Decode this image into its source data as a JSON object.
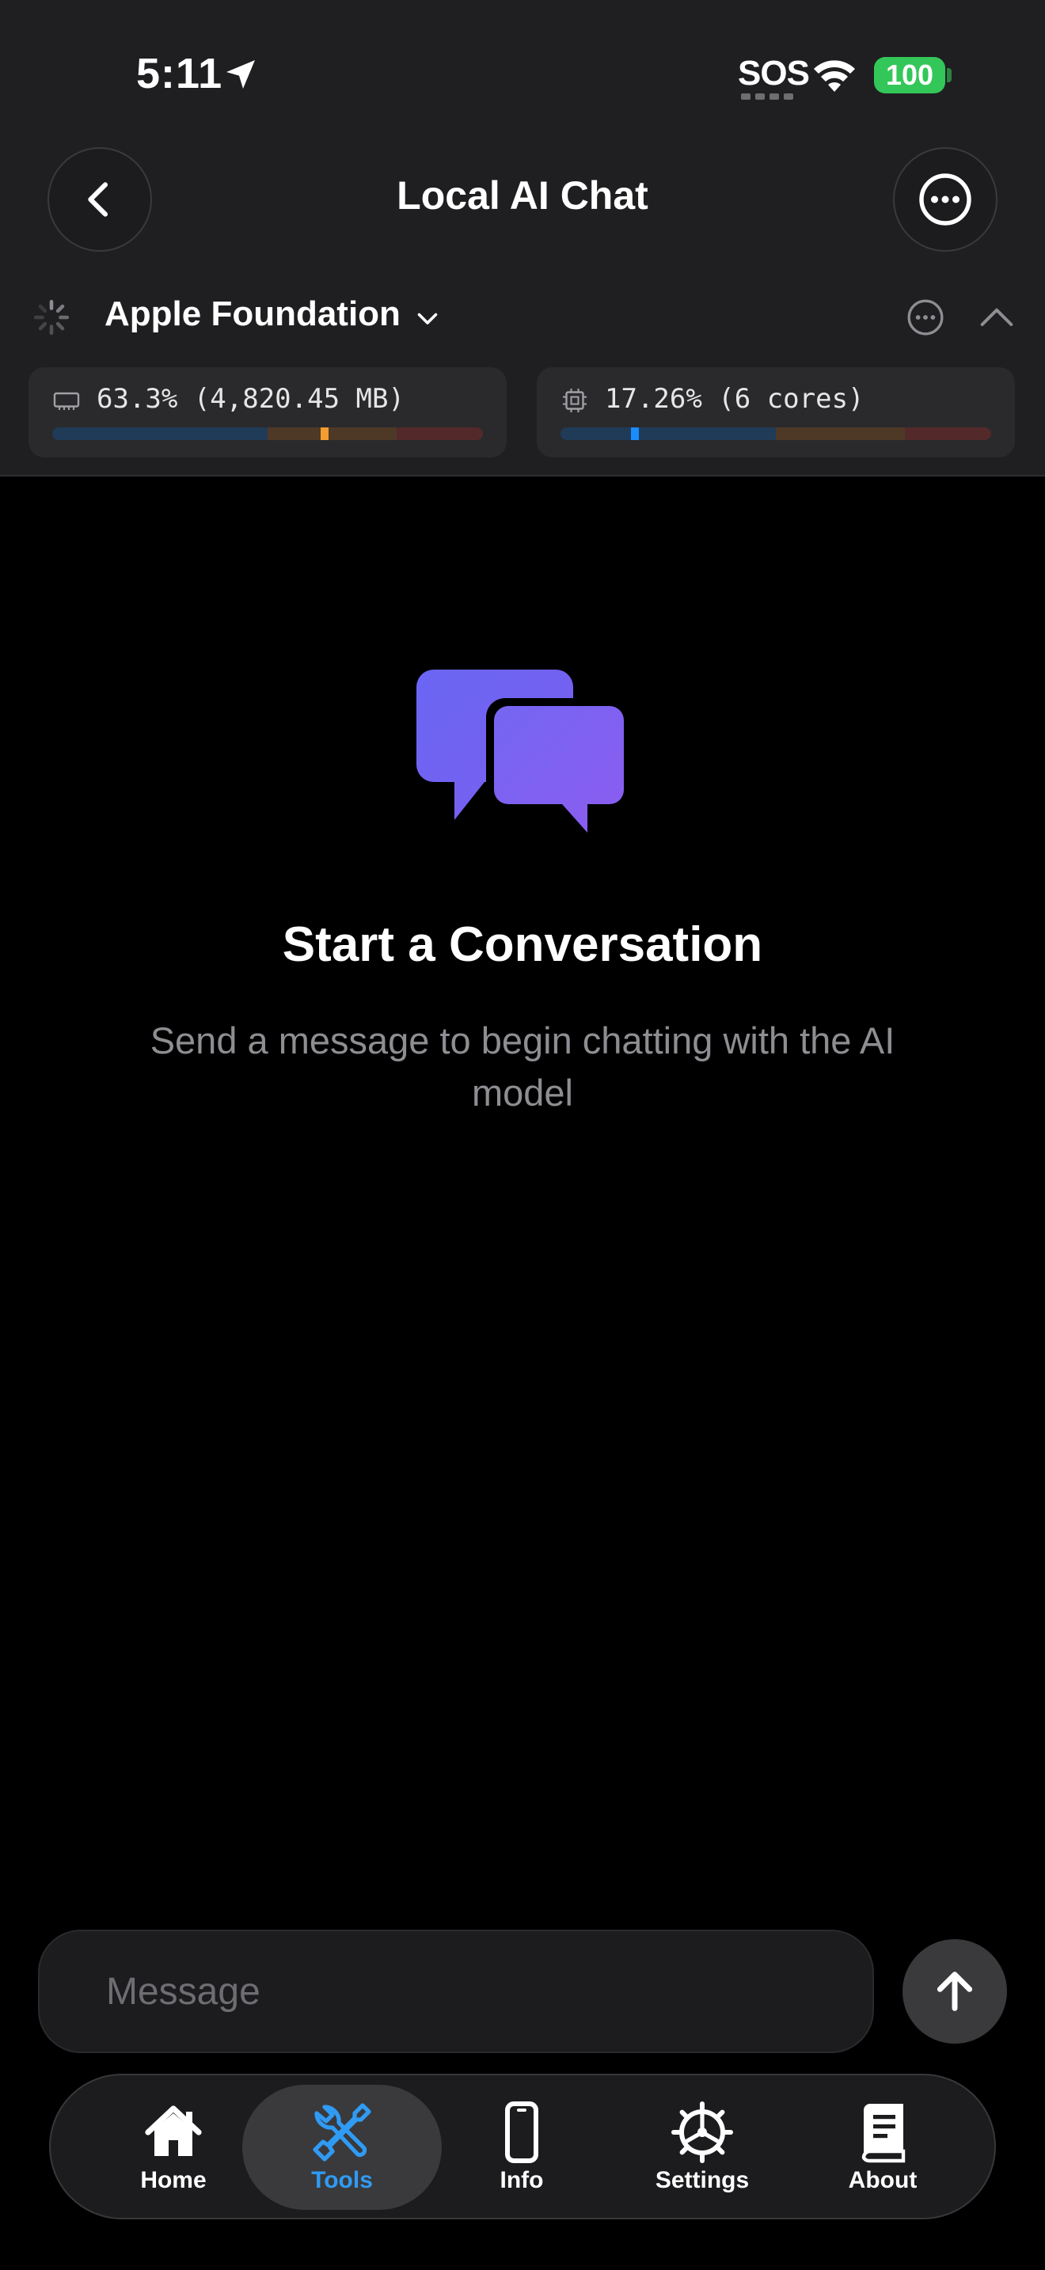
{
  "status_bar": {
    "time": "5:11",
    "sos": "SOS",
    "battery": "100",
    "battery_color": "#33c759"
  },
  "nav": {
    "title": "Local AI Chat",
    "back_icon": "chevron-left-icon",
    "more_icon": "ellipsis-circle-icon"
  },
  "model": {
    "name": "Apple Foundation",
    "memory_text": "63.3% (4,820.45 MB)",
    "memory_level": 0.633,
    "cpu_text": "17.26% (6 cores)",
    "cpu_level": 0.1726,
    "memory_marker_color": "#f59b2f",
    "cpu_marker_color": "#1a8cff"
  },
  "empty_state": {
    "icon": "chat-bubbles-icon",
    "title": "Start a Conversation",
    "subtitle": "Send a message to begin chatting with the AI model",
    "accent_color": "#7b63f0"
  },
  "composer": {
    "placeholder": "Message",
    "send_icon": "arrow-up-icon"
  },
  "tabs": [
    {
      "label": "Home",
      "icon": "house-icon",
      "active": false
    },
    {
      "label": "Tools",
      "icon": "wrench-screwdriver-icon",
      "active": true
    },
    {
      "label": "Info",
      "icon": "phone-icon",
      "active": false
    },
    {
      "label": "Settings",
      "icon": "gear-icon",
      "active": false
    },
    {
      "label": "About",
      "icon": "book-icon",
      "active": false
    }
  ],
  "active_tab_color": "#2f9bf5"
}
